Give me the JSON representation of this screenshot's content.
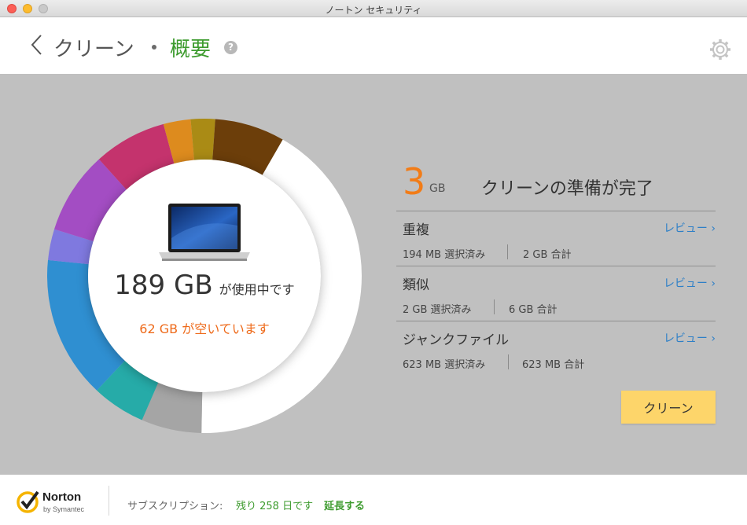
{
  "window": {
    "title": "ノートン セキュリティ"
  },
  "header": {
    "breadcrumb_parent": "クリーン",
    "breadcrumb_current": "概要",
    "help_symbol": "?"
  },
  "disk": {
    "used_value": "189 GB",
    "used_suffix": "が使用中です",
    "free_text": "62 GB が空いています",
    "segments": [
      {
        "color": "#ffffff",
        "fraction": 0.253
      },
      {
        "color": "#a5a5a5",
        "fraction": 0.062
      },
      {
        "color": "#26aba8",
        "fraction": 0.055
      },
      {
        "color": "#2f8fd1",
        "fraction": 0.146
      },
      {
        "color": "#7f79df",
        "fraction": 0.032
      },
      {
        "color": "#a34dc3",
        "fraction": 0.085
      },
      {
        "color": "#c4336d",
        "fraction": 0.075
      },
      {
        "color": "#dd8b1e",
        "fraction": 0.028
      },
      {
        "color": "#aa8b15",
        "fraction": 0.025
      },
      {
        "color": "#6c3e0a",
        "fraction": 0.072
      },
      {
        "color": "#ffffff",
        "fraction": 0.167
      }
    ]
  },
  "summary": {
    "amount": "3",
    "unit": "GB",
    "status": "クリーンの準備が完了"
  },
  "categories": [
    {
      "name": "重複",
      "review": "レビュー",
      "selected": "194 MB 選択済み",
      "total": "2 GB 合計"
    },
    {
      "name": "類似",
      "review": "レビュー",
      "selected": "2 GB 選択済み",
      "total": "6 GB 合計"
    },
    {
      "name": "ジャンクファイル",
      "review": "レビュー",
      "selected": "623 MB 選択済み",
      "total": "623 MB 合計"
    }
  ],
  "actions": {
    "clean_label": "クリーン"
  },
  "footer": {
    "brand": "Norton",
    "brand_sub": "by Symantec",
    "subscription_label": "サブスクリプション:",
    "days_left": "残り 258 日です",
    "renew_label": "延長する"
  },
  "colors": {
    "accent_green": "#3d9b2e",
    "accent_orange": "#f27c17",
    "link_blue": "#2d7fc7",
    "button_yellow": "#fdd56a",
    "panel_gray": "#c0c0c0"
  }
}
